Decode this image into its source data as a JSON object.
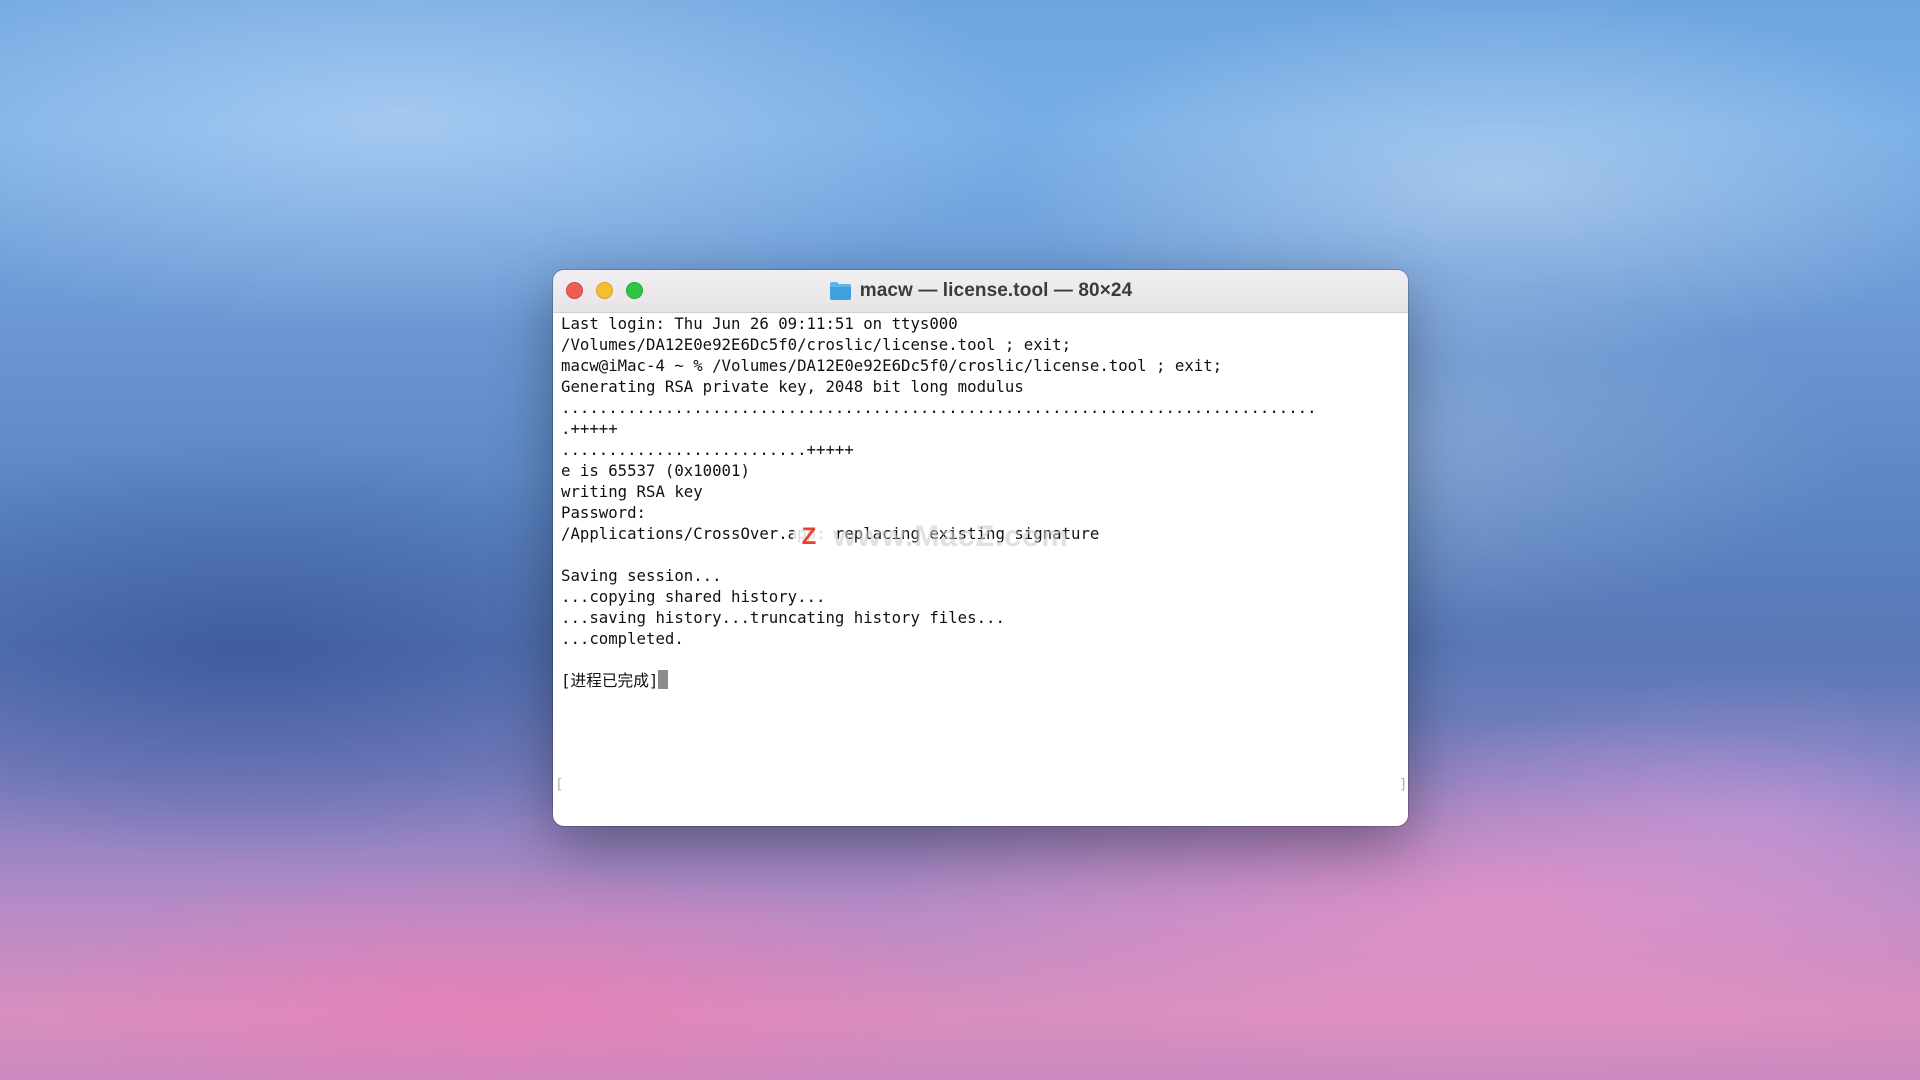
{
  "window": {
    "title": "macw — license.tool — 80×24",
    "title_icon": "folder-icon"
  },
  "terminal": {
    "lines": [
      "Last login: Thu Jun 26 09:11:51 on ttys000",
      "/Volumes/DA12E0e92E6Dc5f0/croslic/license.tool ; exit;",
      "macw@iMac-4 ~ % /Volumes/DA12E0e92E6Dc5f0/croslic/license.tool ; exit;",
      "Generating RSA private key, 2048 bit long modulus",
      "................................................................................",
      ".+++++",
      "..........................+++++",
      "e is 65537 (0x10001)",
      "writing RSA key",
      "Password:",
      "/Applications/CrossOver.app: replacing existing signature",
      "",
      "Saving session...",
      "...copying shared history...",
      "...saving history...truncating history files...",
      "...completed.",
      "",
      "[进程已完成]"
    ]
  },
  "watermark": {
    "logo_letter": "Z",
    "text": "www.MacZ.com"
  },
  "colors": {
    "close": "#ed5f56",
    "minimize": "#f5bd2f",
    "zoom": "#2fc742",
    "terminal_bg": "#ffffff",
    "terminal_text": "#111111"
  }
}
